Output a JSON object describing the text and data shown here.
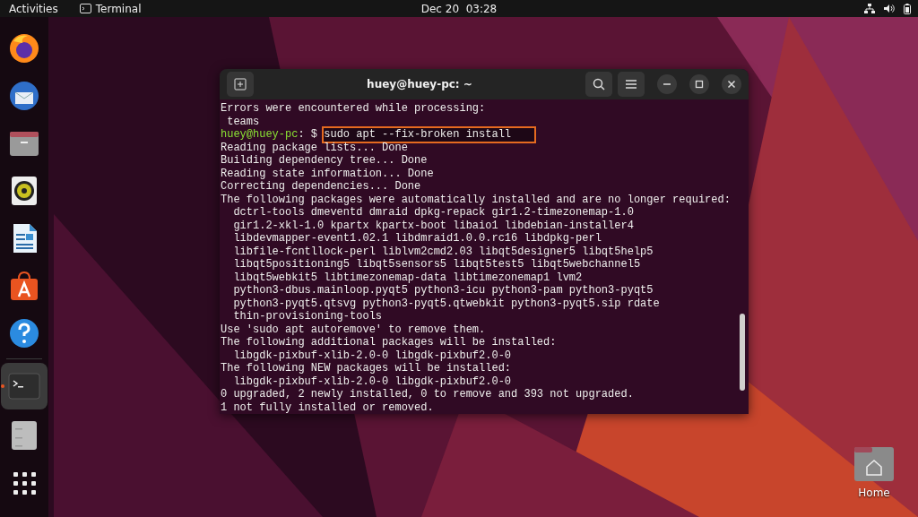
{
  "top_bar": {
    "activities": "Activities",
    "app_name": "Terminal",
    "clock": "Dec 20  03:28"
  },
  "dock": [
    {
      "kind": "browser",
      "selected": false
    },
    {
      "kind": "mail",
      "selected": false
    },
    {
      "kind": "files",
      "selected": false
    },
    {
      "kind": "music",
      "selected": false
    },
    {
      "kind": "document",
      "selected": false
    },
    {
      "kind": "store",
      "selected": false
    },
    {
      "kind": "help",
      "selected": false
    },
    {
      "kind": "terminal",
      "selected": true
    },
    {
      "kind": "drive",
      "selected": false
    },
    {
      "kind": "apps",
      "selected": false
    }
  ],
  "terminal": {
    "title": "huey@huey-pc: ~",
    "lines": [
      {
        "kind": "output",
        "text": "Errors were encountered while processing:"
      },
      {
        "kind": "output",
        "text": " teams"
      },
      {
        "kind": "prompt",
        "user": "huey@huey-pc",
        "path": ": $ ",
        "command": "sudo apt --fix-broken install",
        "highlighted": true
      },
      {
        "kind": "output",
        "text": "Reading package lists... Done"
      },
      {
        "kind": "output",
        "text": "Building dependency tree... Done"
      },
      {
        "kind": "output",
        "text": "Reading state information... Done"
      },
      {
        "kind": "output",
        "text": "Correcting dependencies... Done"
      },
      {
        "kind": "output",
        "text": "The following packages were automatically installed and are no longer required:"
      },
      {
        "kind": "output",
        "text": "  dctrl-tools dmeventd dmraid dpkg-repack gir1.2-timezonemap-1.0"
      },
      {
        "kind": "output",
        "text": "  gir1.2-xkl-1.0 kpartx kpartx-boot libaio1 libdebian-installer4"
      },
      {
        "kind": "output",
        "text": "  libdevmapper-event1.02.1 libdmraid1.0.0.rc16 libdpkg-perl"
      },
      {
        "kind": "output",
        "text": "  libfile-fcntllock-perl liblvm2cmd2.03 libqt5designer5 libqt5help5"
      },
      {
        "kind": "output",
        "text": "  libqt5positioning5 libqt5sensors5 libqt5test5 libqt5webchannel5"
      },
      {
        "kind": "output",
        "text": "  libqt5webkit5 libtimezonemap-data libtimezonemap1 lvm2"
      },
      {
        "kind": "output",
        "text": "  python3-dbus.mainloop.pyqt5 python3-icu python3-pam python3-pyqt5"
      },
      {
        "kind": "output",
        "text": "  python3-pyqt5.qtsvg python3-pyqt5.qtwebkit python3-pyqt5.sip rdate"
      },
      {
        "kind": "output",
        "text": "  thin-provisioning-tools"
      },
      {
        "kind": "output",
        "text": "Use 'sudo apt autoremove' to remove them."
      },
      {
        "kind": "output",
        "text": "The following additional packages will be installed:"
      },
      {
        "kind": "output",
        "text": "  libgdk-pixbuf-xlib-2.0-0 libgdk-pixbuf2.0-0"
      },
      {
        "kind": "output",
        "text": "The following NEW packages will be installed:"
      },
      {
        "kind": "output",
        "text": "  libgdk-pixbuf-xlib-2.0-0 libgdk-pixbuf2.0-0"
      },
      {
        "kind": "output",
        "text": "0 upgraded, 2 newly installed, 0 to remove and 393 not upgraded."
      },
      {
        "kind": "output",
        "text": "1 not fully installed or removed."
      }
    ]
  },
  "desktop_icons": [
    {
      "label": "Home"
    }
  ]
}
